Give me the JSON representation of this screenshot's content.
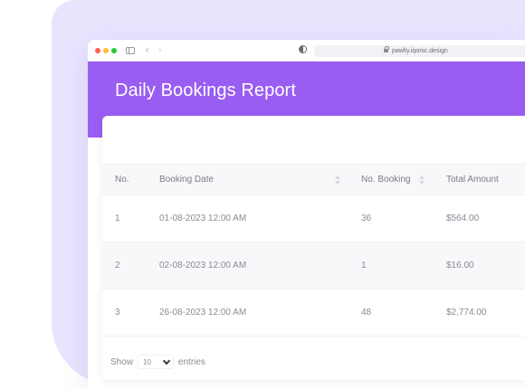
{
  "browser": {
    "url": "pawlly.iqonic.design"
  },
  "page": {
    "title": "Daily Bookings Report"
  },
  "table": {
    "headers": {
      "no": "No.",
      "date": "Booking Date",
      "count": "No. Booking",
      "amount": "Total Amount"
    },
    "rows": [
      {
        "no": "1",
        "date": "01-08-2023 12:00 AM",
        "count": "36",
        "amount": "$564.00"
      },
      {
        "no": "2",
        "date": "02-08-2023 12:00 AM",
        "count": "1",
        "amount": "$16.00"
      },
      {
        "no": "3",
        "date": "26-08-2023 12:00 AM",
        "count": "48",
        "amount": "$2,774.00"
      }
    ]
  },
  "footer": {
    "show_label": "Show",
    "page_size": "10",
    "entries_label": "entries"
  },
  "colors": {
    "accent": "#9a5df2",
    "backdrop": "#e9e4fe"
  },
  "icons": [
    "sidebar-icon",
    "back-icon",
    "forward-icon",
    "shield-icon",
    "lock-icon",
    "sort-icon",
    "chevron-down-icon"
  ]
}
